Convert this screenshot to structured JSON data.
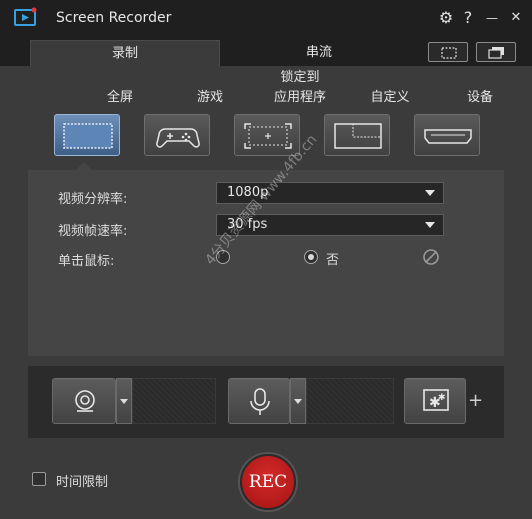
{
  "app": {
    "title": "Screen Recorder"
  },
  "window_controls": {
    "settings": "⚙",
    "help": "?",
    "minimize": "—",
    "close": "✕"
  },
  "tabs": [
    {
      "label": "录制",
      "active": true
    },
    {
      "label": "串流",
      "active": false
    }
  ],
  "modes": [
    {
      "label": "全屏",
      "icon": "fullscreen-icon",
      "selected": true
    },
    {
      "label": "游戏",
      "icon": "gamepad-icon",
      "selected": false
    },
    {
      "label": "锁定到\n应用程序",
      "label_line1": "锁定到",
      "label_line2": "应用程序",
      "icon": "lock-to-app-icon",
      "selected": false
    },
    {
      "label": "自定义",
      "icon": "custom-region-icon",
      "selected": false
    },
    {
      "label": "设备",
      "icon": "hdmi-device-icon",
      "selected": false
    }
  ],
  "settings": {
    "resolution_label": "视频分辨率:",
    "resolution_value": "1080p",
    "framerate_label": "视频帧速率:",
    "framerate_value": "30 fps",
    "mouse_click_label": "单击鼠标:",
    "mouse_click_options": [
      "",
      "否"
    ],
    "mouse_click_selected": "否"
  },
  "devices": {
    "webcam_icon": "webcam-icon",
    "microphone_icon": "microphone-icon",
    "effects_icon": "effects-icon",
    "add": "+"
  },
  "footer": {
    "time_limit_label": "时间限制",
    "time_limit_checked": false,
    "rec_label": "REC"
  },
  "watermark": "4分贝资源网 www.4fb.cn",
  "colors": {
    "background": "#3b3b3b",
    "titlebar": "#1f1f1f",
    "selected_mode": "#5379a6",
    "rec_button": "#c41e1e"
  }
}
